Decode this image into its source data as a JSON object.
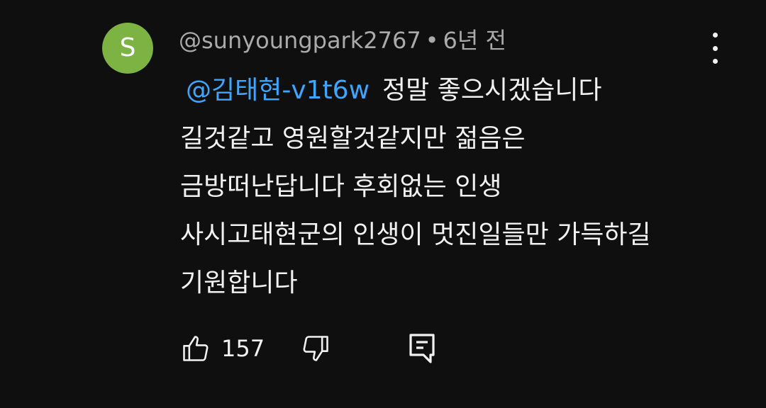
{
  "comment": {
    "avatar_letter": "S",
    "avatar_color": "#7cb342",
    "author": "@sunyoungpark2767",
    "separator": "•",
    "time": "6년 전",
    "mention": "@김태현-v1t6w",
    "text_lines": [
      "정말 좋으시겠습니다",
      "길것같고 영원할것같지만 젊음은",
      "금방떠난답니다 후회없는 인생",
      "사시고태현군의 인생이 멋진일들만 가득하길",
      "기원합니다"
    ],
    "like_count": "157",
    "mention_color": "#3ea6ff"
  },
  "icons": {
    "more": "more-vertical-icon",
    "like": "thumbs-up-icon",
    "dislike": "thumbs-down-icon",
    "reply": "reply-comment-icon"
  }
}
